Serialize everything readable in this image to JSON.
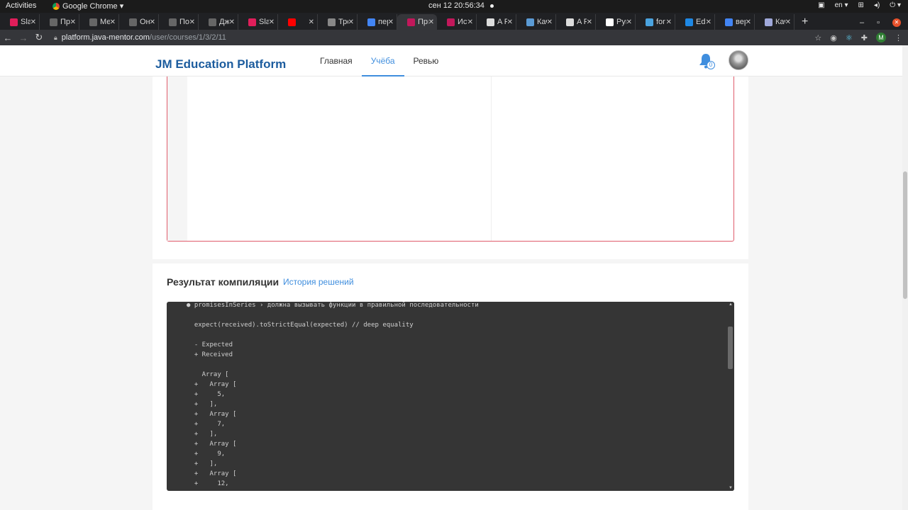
{
  "system": {
    "activities": "Activities",
    "app_name": "Google Chrome ▾",
    "clock": "сен 12  20:56:34",
    "lang": "en ▾"
  },
  "tabs": [
    {
      "title": "Sla",
      "color": "#e01e5a"
    },
    {
      "title": "При",
      "color": "#666666"
    },
    {
      "title": "Ме",
      "color": "#666666"
    },
    {
      "title": "Он",
      "color": "#666666"
    },
    {
      "title": "По",
      "color": "#666666"
    },
    {
      "title": "Дж",
      "color": "#666666"
    },
    {
      "title": "Sla",
      "color": "#e01e5a"
    },
    {
      "title": "",
      "color": "#ff0000"
    },
    {
      "title": "Тре",
      "color": "#888888"
    },
    {
      "title": "пер",
      "color": "#4285f4"
    },
    {
      "title": "При",
      "color": "#c2185b",
      "active": true
    },
    {
      "title": "Ист",
      "color": "#c2185b"
    },
    {
      "title": "A F",
      "color": "#dddddd"
    },
    {
      "title": "Кач",
      "color": "#5b9bd5"
    },
    {
      "title": "A F",
      "color": "#dddddd"
    },
    {
      "title": "Рук",
      "color": "#ffffff"
    },
    {
      "title": "for",
      "color": "#4aa3df"
    },
    {
      "title": "Edi",
      "color": "#1e88e5"
    },
    {
      "title": "вер",
      "color": "#4285f4"
    },
    {
      "title": "Кач",
      "color": "#9fa8da"
    }
  ],
  "url": {
    "host": "platform.java-mentor.com",
    "path": "/user/courses/1/3/2/11"
  },
  "profile_initial": "M",
  "site": {
    "brand": "JM Education Platform",
    "nav": [
      "Главная",
      "Учёба",
      "Ревью"
    ],
    "active_nav_index": 1,
    "notifications": "0"
  },
  "result": {
    "title": "Результат компиляции",
    "history_link": "История решений"
  },
  "console_lines": [
    "● promisesInSeries › должна вызывать функции в правильной последовательности",
    "",
    "  expect(received).toStrictEqual(expected) // deep equality",
    "",
    "  - Expected",
    "  + Received",
    "",
    "    Array [",
    "  +   Array [",
    "  +     5,",
    "  +   ],",
    "  +   Array [",
    "  +     7,",
    "  +   ],",
    "  +   Array [",
    "  +     9,",
    "  +   ],",
    "  +   Array [",
    "  +     12,"
  ],
  "icons": {
    "bell": "bell-icon",
    "lock": "lock-icon",
    "star": "star-icon"
  }
}
